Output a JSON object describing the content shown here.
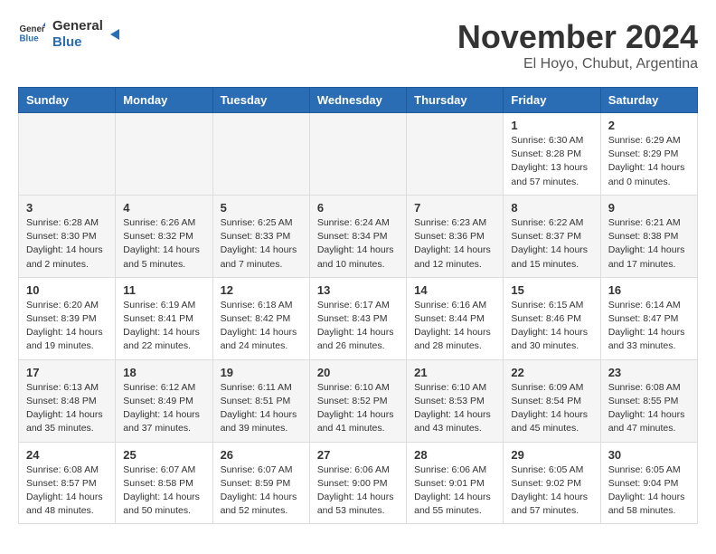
{
  "logo": {
    "text_general": "General",
    "text_blue": "Blue"
  },
  "header": {
    "month_year": "November 2024",
    "location": "El Hoyo, Chubut, Argentina"
  },
  "weekdays": [
    "Sunday",
    "Monday",
    "Tuesday",
    "Wednesday",
    "Thursday",
    "Friday",
    "Saturday"
  ],
  "weeks": [
    [
      {
        "day": "",
        "info": ""
      },
      {
        "day": "",
        "info": ""
      },
      {
        "day": "",
        "info": ""
      },
      {
        "day": "",
        "info": ""
      },
      {
        "day": "",
        "info": ""
      },
      {
        "day": "1",
        "info": "Sunrise: 6:30 AM\nSunset: 8:28 PM\nDaylight: 13 hours\nand 57 minutes."
      },
      {
        "day": "2",
        "info": "Sunrise: 6:29 AM\nSunset: 8:29 PM\nDaylight: 14 hours\nand 0 minutes."
      }
    ],
    [
      {
        "day": "3",
        "info": "Sunrise: 6:28 AM\nSunset: 8:30 PM\nDaylight: 14 hours\nand 2 minutes."
      },
      {
        "day": "4",
        "info": "Sunrise: 6:26 AM\nSunset: 8:32 PM\nDaylight: 14 hours\nand 5 minutes."
      },
      {
        "day": "5",
        "info": "Sunrise: 6:25 AM\nSunset: 8:33 PM\nDaylight: 14 hours\nand 7 minutes."
      },
      {
        "day": "6",
        "info": "Sunrise: 6:24 AM\nSunset: 8:34 PM\nDaylight: 14 hours\nand 10 minutes."
      },
      {
        "day": "7",
        "info": "Sunrise: 6:23 AM\nSunset: 8:36 PM\nDaylight: 14 hours\nand 12 minutes."
      },
      {
        "day": "8",
        "info": "Sunrise: 6:22 AM\nSunset: 8:37 PM\nDaylight: 14 hours\nand 15 minutes."
      },
      {
        "day": "9",
        "info": "Sunrise: 6:21 AM\nSunset: 8:38 PM\nDaylight: 14 hours\nand 17 minutes."
      }
    ],
    [
      {
        "day": "10",
        "info": "Sunrise: 6:20 AM\nSunset: 8:39 PM\nDaylight: 14 hours\nand 19 minutes."
      },
      {
        "day": "11",
        "info": "Sunrise: 6:19 AM\nSunset: 8:41 PM\nDaylight: 14 hours\nand 22 minutes."
      },
      {
        "day": "12",
        "info": "Sunrise: 6:18 AM\nSunset: 8:42 PM\nDaylight: 14 hours\nand 24 minutes."
      },
      {
        "day": "13",
        "info": "Sunrise: 6:17 AM\nSunset: 8:43 PM\nDaylight: 14 hours\nand 26 minutes."
      },
      {
        "day": "14",
        "info": "Sunrise: 6:16 AM\nSunset: 8:44 PM\nDaylight: 14 hours\nand 28 minutes."
      },
      {
        "day": "15",
        "info": "Sunrise: 6:15 AM\nSunset: 8:46 PM\nDaylight: 14 hours\nand 30 minutes."
      },
      {
        "day": "16",
        "info": "Sunrise: 6:14 AM\nSunset: 8:47 PM\nDaylight: 14 hours\nand 33 minutes."
      }
    ],
    [
      {
        "day": "17",
        "info": "Sunrise: 6:13 AM\nSunset: 8:48 PM\nDaylight: 14 hours\nand 35 minutes."
      },
      {
        "day": "18",
        "info": "Sunrise: 6:12 AM\nSunset: 8:49 PM\nDaylight: 14 hours\nand 37 minutes."
      },
      {
        "day": "19",
        "info": "Sunrise: 6:11 AM\nSunset: 8:51 PM\nDaylight: 14 hours\nand 39 minutes."
      },
      {
        "day": "20",
        "info": "Sunrise: 6:10 AM\nSunset: 8:52 PM\nDaylight: 14 hours\nand 41 minutes."
      },
      {
        "day": "21",
        "info": "Sunrise: 6:10 AM\nSunset: 8:53 PM\nDaylight: 14 hours\nand 43 minutes."
      },
      {
        "day": "22",
        "info": "Sunrise: 6:09 AM\nSunset: 8:54 PM\nDaylight: 14 hours\nand 45 minutes."
      },
      {
        "day": "23",
        "info": "Sunrise: 6:08 AM\nSunset: 8:55 PM\nDaylight: 14 hours\nand 47 minutes."
      }
    ],
    [
      {
        "day": "24",
        "info": "Sunrise: 6:08 AM\nSunset: 8:57 PM\nDaylight: 14 hours\nand 48 minutes."
      },
      {
        "day": "25",
        "info": "Sunrise: 6:07 AM\nSunset: 8:58 PM\nDaylight: 14 hours\nand 50 minutes."
      },
      {
        "day": "26",
        "info": "Sunrise: 6:07 AM\nSunset: 8:59 PM\nDaylight: 14 hours\nand 52 minutes."
      },
      {
        "day": "27",
        "info": "Sunrise: 6:06 AM\nSunset: 9:00 PM\nDaylight: 14 hours\nand 53 minutes."
      },
      {
        "day": "28",
        "info": "Sunrise: 6:06 AM\nSunset: 9:01 PM\nDaylight: 14 hours\nand 55 minutes."
      },
      {
        "day": "29",
        "info": "Sunrise: 6:05 AM\nSunset: 9:02 PM\nDaylight: 14 hours\nand 57 minutes."
      },
      {
        "day": "30",
        "info": "Sunrise: 6:05 AM\nSunset: 9:04 PM\nDaylight: 14 hours\nand 58 minutes."
      }
    ]
  ]
}
